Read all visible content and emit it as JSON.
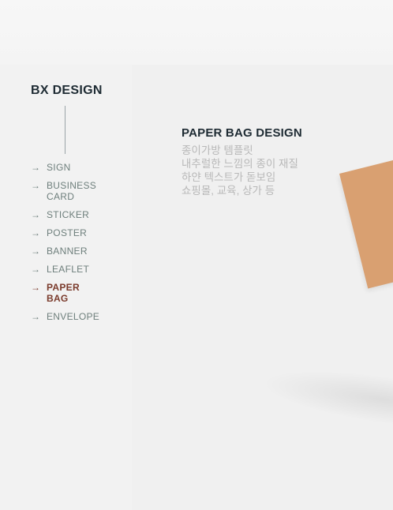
{
  "brand": {
    "title": "BX DESIGN"
  },
  "nav": {
    "arrow_glyph": "→",
    "items": [
      {
        "label": "SIGN",
        "active": false
      },
      {
        "label": "BUSINESS CARD",
        "active": false
      },
      {
        "label": "STICKER",
        "active": false
      },
      {
        "label": "POSTER",
        "active": false
      },
      {
        "label": "BANNER",
        "active": false
      },
      {
        "label": "LEAFLET",
        "active": false
      },
      {
        "label": "PAPER BAG",
        "active": true
      },
      {
        "label": "ENVELOPE",
        "active": false
      }
    ]
  },
  "section": {
    "title": "PAPER BAG DESIGN",
    "description": [
      "종이가방 템플릿",
      "내추럴한 느낌의 종이 재질",
      "하얀 텍스트가 돋보임",
      "쇼핑몰, 교육, 상가 등"
    ]
  },
  "colors": {
    "accent": "#7a3a2b",
    "nav_text": "#6e7f7c",
    "heading": "#1e2b33",
    "bag": "#d9a071"
  }
}
